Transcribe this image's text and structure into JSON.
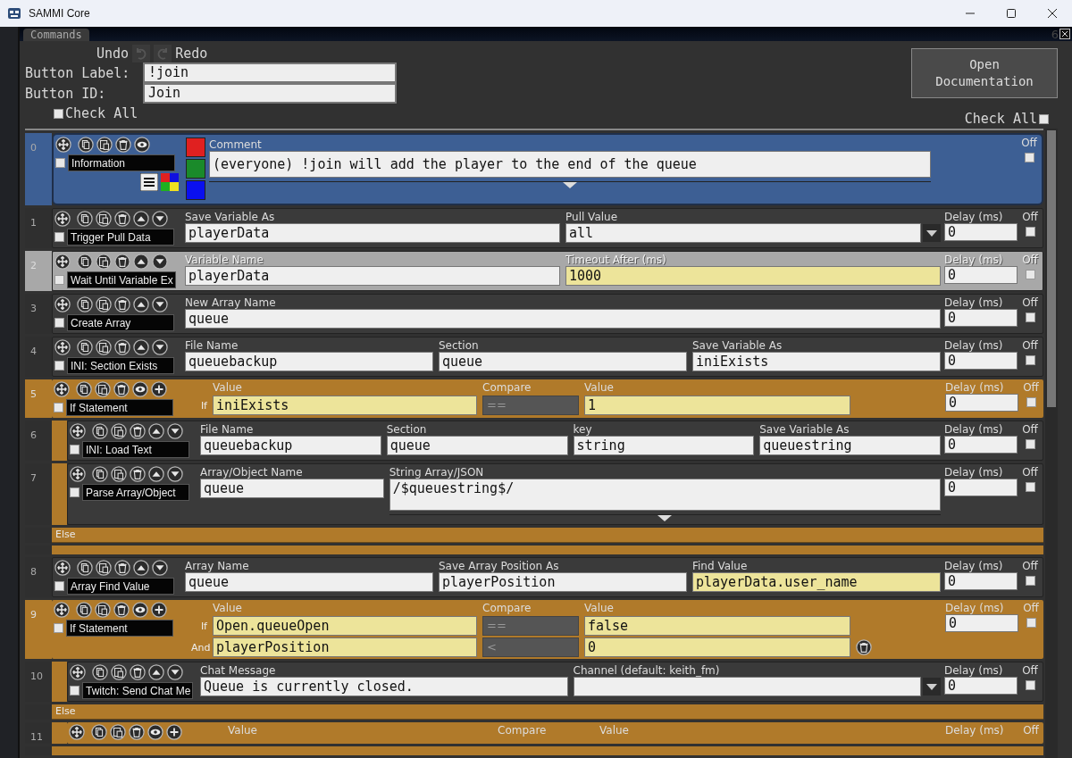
{
  "window": {
    "title": "SAMMI Core"
  },
  "panel": {
    "tab": "Commands",
    "badge": "6"
  },
  "toolbar": {
    "undo": "Undo",
    "redo": "Redo"
  },
  "button_label": {
    "label": "Button Label:",
    "value": "!join"
  },
  "button_id": {
    "label": "Button ID:",
    "value": "Join"
  },
  "open_documentation": "Open Documentation",
  "check_all": [
    {
      "label": "Check All",
      "checked": false
    },
    {
      "label": "Check All",
      "checked": false
    }
  ],
  "commands": [
    {
      "index": "0",
      "kind": "comment",
      "name": "Information",
      "checked": false,
      "selected": false,
      "fields": [
        {
          "label": "Comment",
          "value": "(everyone) !join will add the player to the end of the queue",
          "kind": "text"
        }
      ],
      "swatches": [
        {
          "color": "#e02020"
        },
        {
          "color": "#1a8a2a"
        },
        {
          "color": "#0a10f0"
        }
      ],
      "off": {
        "label": "Off",
        "checked": false
      }
    },
    {
      "index": "1",
      "kind": "action",
      "name": "Trigger Pull Data",
      "checked": false,
      "selected": false,
      "fields": [
        {
          "label": "Save Variable As",
          "value": "playerData",
          "kind": "text"
        },
        {
          "label": "Pull Value",
          "value": "all",
          "kind": "dropdown"
        }
      ],
      "delay": {
        "label": "Delay (ms)",
        "value": "0"
      },
      "off": {
        "label": "Off",
        "checked": false
      }
    },
    {
      "index": "2",
      "kind": "action",
      "name": "Wait Until Variable Ex",
      "checked": false,
      "selected": true,
      "fields": [
        {
          "label": "Variable Name",
          "value": "playerData",
          "kind": "text"
        },
        {
          "label": "Timeout After (ms)",
          "value": "1000",
          "kind": "variable"
        }
      ],
      "delay": {
        "label": "Delay (ms)",
        "value": "0"
      },
      "off": {
        "label": "Off",
        "checked": false
      }
    },
    {
      "index": "3",
      "kind": "action",
      "name": "Create Array",
      "checked": false,
      "selected": false,
      "fields": [
        {
          "label": "New Array Name",
          "value": "queue",
          "kind": "text"
        }
      ],
      "delay": {
        "label": "Delay (ms)",
        "value": "0"
      },
      "off": {
        "label": "Off",
        "checked": false
      }
    },
    {
      "index": "4",
      "kind": "action",
      "name": "INI: Section Exists",
      "checked": false,
      "selected": false,
      "fields": [
        {
          "label": "File Name",
          "value": "queuebackup",
          "kind": "text"
        },
        {
          "label": "Section",
          "value": "queue",
          "kind": "text"
        },
        {
          "label": "Save Variable As",
          "value": "iniExists",
          "kind": "text"
        }
      ],
      "delay": {
        "label": "Delay (ms)",
        "value": "0"
      },
      "off": {
        "label": "Off",
        "checked": false
      }
    },
    {
      "index": "5",
      "kind": "if",
      "name": "If Statement",
      "checked": false,
      "selected": false,
      "headers": [
        "Value",
        "Compare",
        "Value"
      ],
      "conditions": [
        {
          "joiner": "If",
          "value": "iniExists",
          "compare": "==",
          "value2": "1",
          "removable": false
        }
      ],
      "delay": {
        "label": "Delay (ms)",
        "value": "0"
      },
      "off": {
        "label": "Off",
        "checked": false
      },
      "children": [
        {
          "index": "6",
          "kind": "action",
          "name": "INI: Load Text",
          "checked": false,
          "selected": false,
          "fields": [
            {
              "label": "File Name",
              "value": "queuebackup",
              "kind": "text"
            },
            {
              "label": "Section",
              "value": "queue",
              "kind": "text"
            },
            {
              "label": "key",
              "value": "string",
              "kind": "text"
            },
            {
              "label": "Save Variable As",
              "value": "queuestring",
              "kind": "text"
            }
          ],
          "delay": {
            "label": "Delay (ms)",
            "value": "0"
          },
          "off": {
            "label": "Off",
            "checked": false
          }
        },
        {
          "index": "7",
          "kind": "action",
          "name": "Parse Array/Object",
          "checked": false,
          "selected": false,
          "fields": [
            {
              "label": "Array/Object Name",
              "value": "queue",
              "kind": "text"
            },
            {
              "label": "String Array/JSON",
              "value": "/$queuestring$/",
              "kind": "multiline"
            }
          ],
          "delay": {
            "label": "Delay (ms)",
            "value": "0"
          },
          "off": {
            "label": "Off",
            "checked": false
          }
        }
      ],
      "else_label": "Else"
    },
    {
      "index": "8",
      "kind": "action",
      "name": "Array Find Value",
      "checked": false,
      "selected": false,
      "fields": [
        {
          "label": "Array Name",
          "value": "queue",
          "kind": "text"
        },
        {
          "label": "Save Array Position As",
          "value": "playerPosition",
          "kind": "text"
        },
        {
          "label": "Find Value",
          "value": "playerData.user_name",
          "kind": "variable"
        }
      ],
      "delay": {
        "label": "Delay (ms)",
        "value": "0"
      },
      "off": {
        "label": "Off",
        "checked": false
      }
    },
    {
      "index": "9",
      "kind": "if",
      "name": "If Statement",
      "checked": false,
      "selected": false,
      "headers": [
        "Value",
        "Compare",
        "Value"
      ],
      "conditions": [
        {
          "joiner": "If",
          "value": "Open.queueOpen",
          "compare": "==",
          "value2": "false",
          "removable": false
        },
        {
          "joiner": "And",
          "value": "playerPosition",
          "compare": "<",
          "value2": "0",
          "removable": true
        }
      ],
      "delay": {
        "label": "Delay (ms)",
        "value": "0"
      },
      "off": {
        "label": "Off",
        "checked": false
      },
      "children": [
        {
          "index": "10",
          "kind": "action",
          "name": "Twitch: Send Chat Me",
          "checked": false,
          "selected": false,
          "fields": [
            {
              "label": "Chat Message",
              "value": "Queue is currently closed.",
              "kind": "text"
            },
            {
              "label": "Channel (default: keith_fm)",
              "kind": "dropdown"
            }
          ],
          "delay": {
            "label": "Delay (ms)",
            "value": "0"
          },
          "off": {
            "label": "Off",
            "checked": false
          }
        }
      ],
      "else_label": "Else",
      "else_children": [
        {
          "index": "11",
          "kind": "if",
          "selected": false,
          "headers": [
            "Value",
            "Compare",
            "Value"
          ],
          "delay": {
            "label": "Delay (ms)"
          },
          "off": {
            "label": "Off"
          }
        }
      ]
    }
  ]
}
